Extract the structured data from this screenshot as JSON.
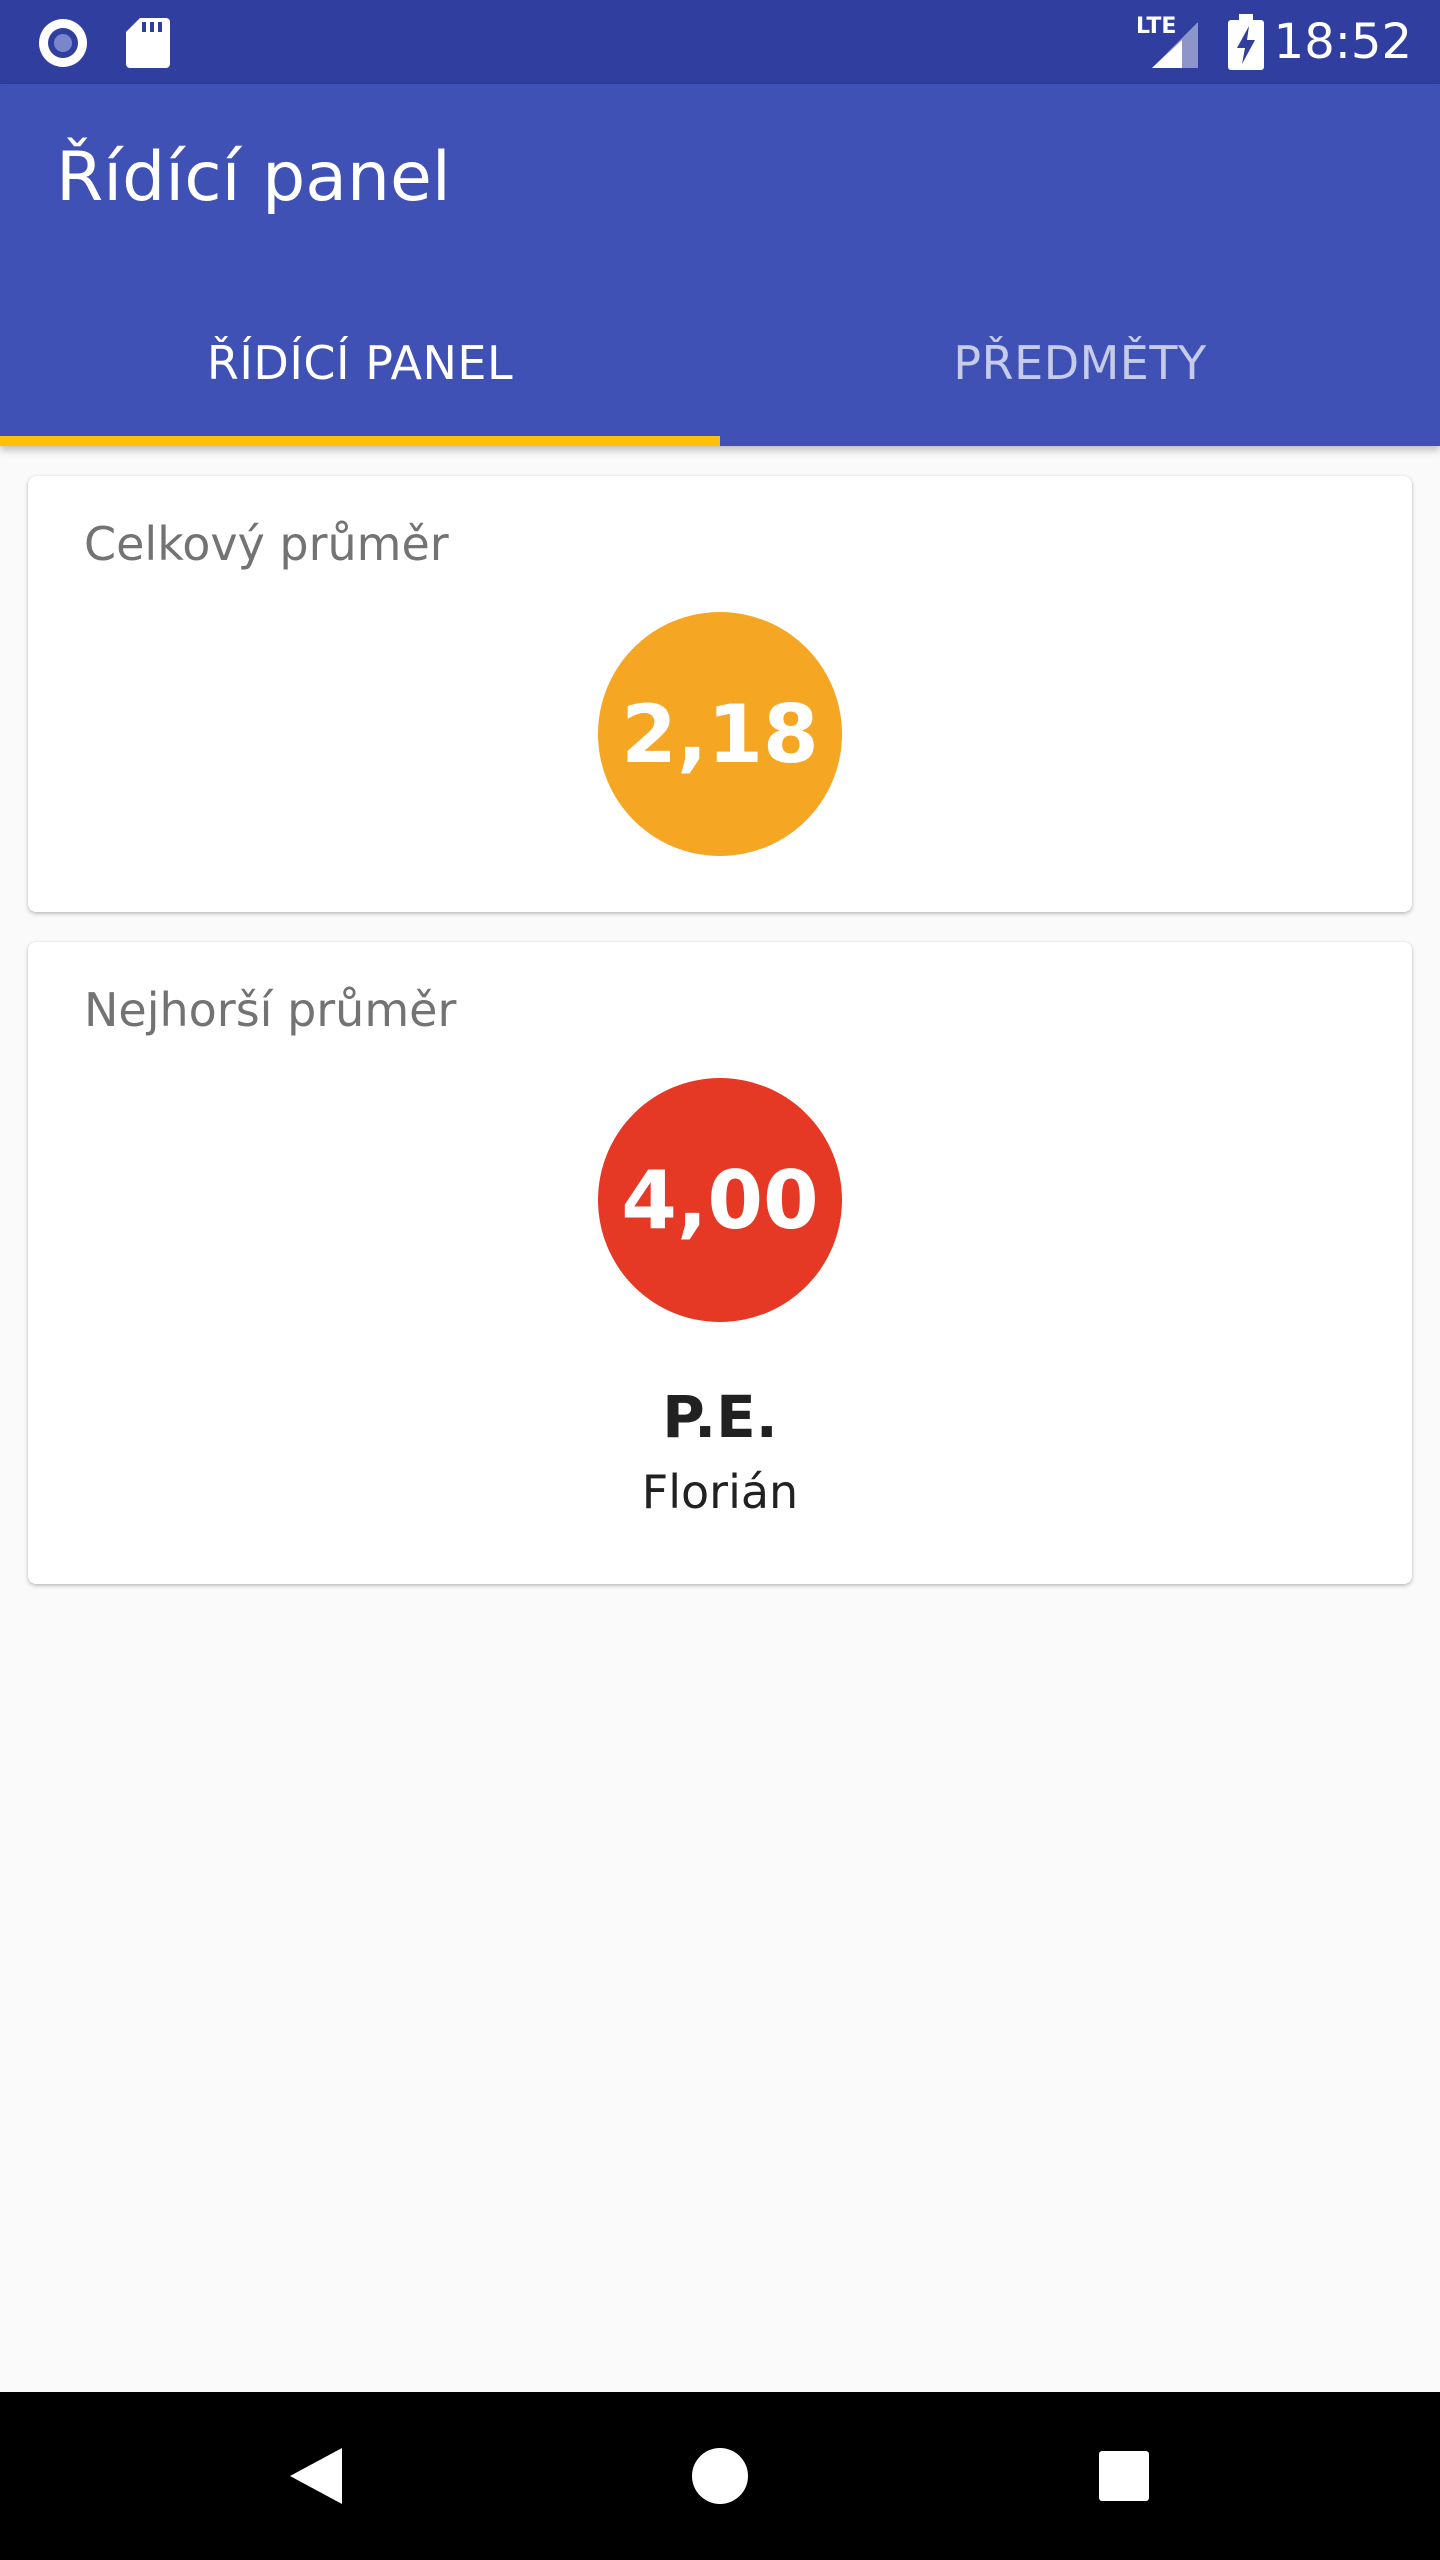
{
  "status_bar": {
    "time": "18:52",
    "network_label": "LTE",
    "icons": [
      "circle-notification-icon",
      "sd-card-icon",
      "signal-lte-icon",
      "battery-charging-icon"
    ]
  },
  "app_bar": {
    "title": "Řídící panel"
  },
  "tabs": [
    {
      "label": "ŘÍDÍCÍ PANEL",
      "active": true
    },
    {
      "label": "PŘEDMĚTY",
      "active": false
    }
  ],
  "cards": {
    "overall": {
      "title": "Celkový průměr",
      "value": "2,18",
      "color": "#f5a623"
    },
    "worst": {
      "title": "Nejhorší průměr",
      "value": "4,00",
      "color": "#e53925",
      "subject": "P.E.",
      "teacher": "Florián"
    }
  },
  "colors": {
    "status_bar": "#303f9f",
    "primary": "#3f51b5",
    "accent": "#ffc107",
    "background": "#fafafa"
  },
  "nav_bar": {
    "icons": [
      "back-icon",
      "home-icon",
      "recents-icon"
    ]
  }
}
